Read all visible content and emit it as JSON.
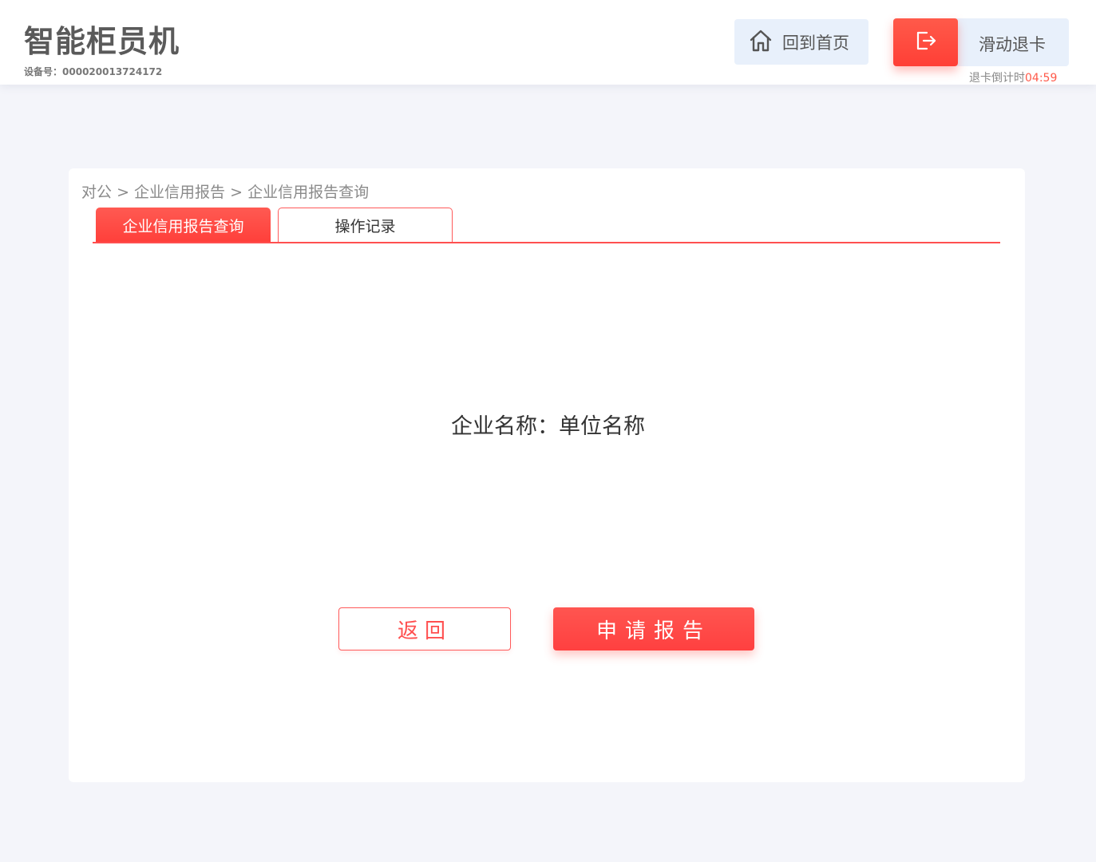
{
  "header": {
    "app_title": "智能柜员机",
    "device_label": "设备号：",
    "device_number": "000020013724172",
    "home_button": {
      "label": "回到首页",
      "icon": "home-icon"
    },
    "exit_slider": {
      "label": "滑动退卡",
      "icon": "exit-icon",
      "knob_color": "#ff4f45"
    },
    "countdown": {
      "label": "退卡倒计时",
      "time": "04:59"
    }
  },
  "breadcrumb": {
    "items": [
      "对公",
      "企业信用报告",
      "企业信用报告查询"
    ],
    "separator": ">"
  },
  "tabs": [
    {
      "label": "企业信用报告查询",
      "active": true
    },
    {
      "label": "操作记录",
      "active": false
    }
  ],
  "content": {
    "company_label": "企业名称：",
    "company_value": "单位名称"
  },
  "actions": {
    "back_label": "返回",
    "apply_label": "申请报告"
  },
  "colors": {
    "accent": "#ff4f4f",
    "home_bg": "#e8f0fb",
    "page_bg": "#f4f5fa"
  }
}
